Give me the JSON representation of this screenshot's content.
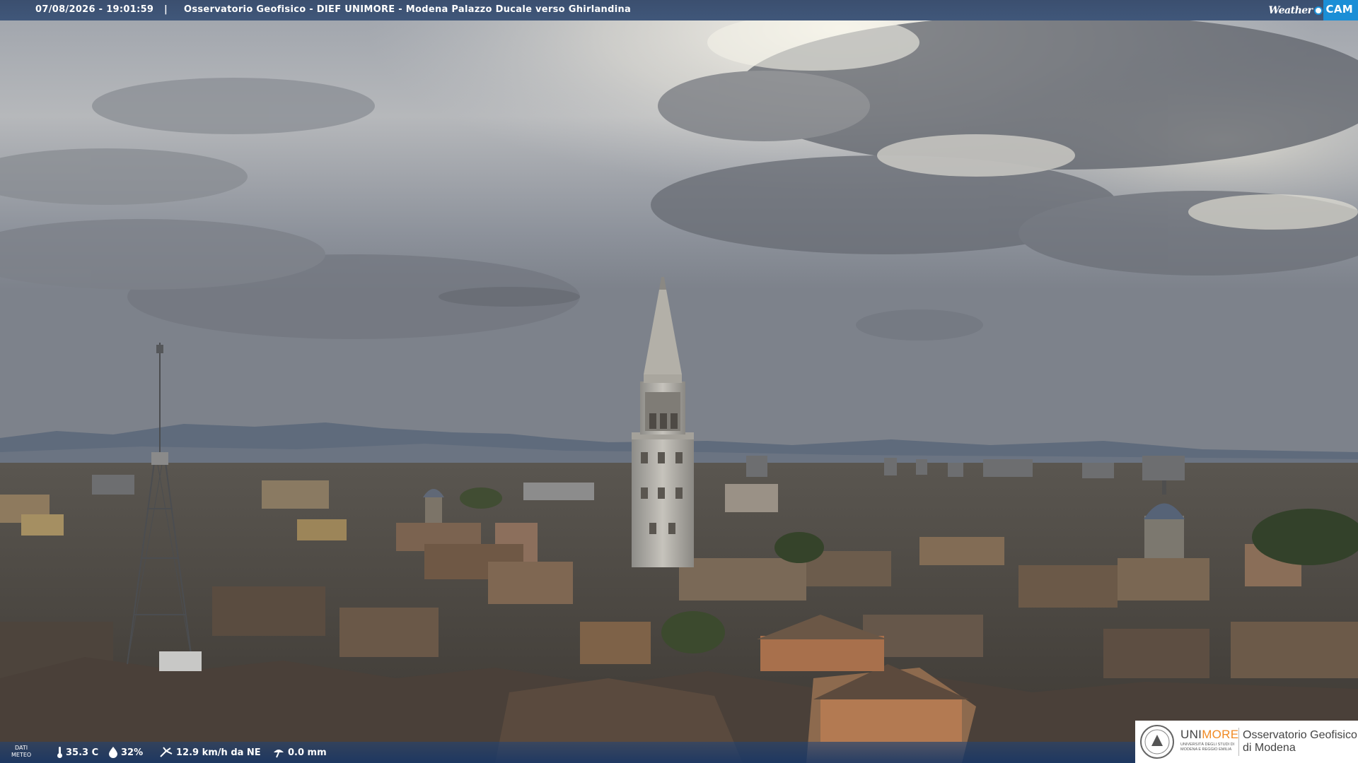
{
  "overlay": {
    "timestamp": "07/08/2026 - 19:01:59",
    "separator": "|",
    "title": "Osservatorio Geofisico - DIEF UNIMORE - Modena Palazzo Ducale verso Ghirlandina"
  },
  "brand": {
    "weather": "Weather",
    "cam": "CAM",
    "accent": "#1b8ed6"
  },
  "meteo": {
    "label_line1": "DATI",
    "label_line2": "METEO",
    "temperature": "35.3 C",
    "humidity": "32%",
    "wind": "12.9 km/h da NE",
    "rain": "0.0 mm"
  },
  "institution": {
    "name_part1": "UNI",
    "name_part2": "MORE",
    "name_color": "#f08a24",
    "subline": "UNIVERSITÀ DEGLI STUDI DI MODENA E REGGIO EMILIA",
    "observatory_line1": "Osservatorio Geofisico",
    "observatory_line2": "di Modena"
  }
}
